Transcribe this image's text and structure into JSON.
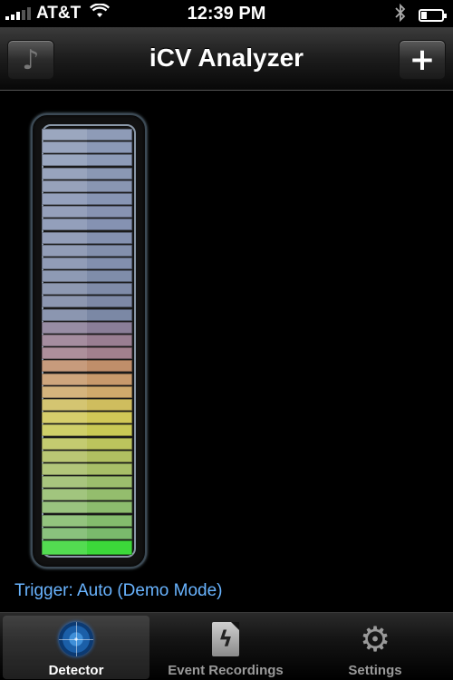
{
  "status_bar": {
    "carrier": "AT&T",
    "time": "12:39 PM",
    "signal_bars_filled": 3,
    "signal_bars_total": 5,
    "battery_level": 0.25
  },
  "nav": {
    "title": "iCV Analyzer",
    "left_icon": "music-note-icon",
    "right_icon": "plus-icon"
  },
  "meter": {
    "bar_colors": [
      "#8e9bb7",
      "#8b99b7",
      "#8d9bb8",
      "#8a98b4",
      "#8996b2",
      "#8795b4",
      "#8793b2",
      "#8592b2",
      "#8491b0",
      "#8390ad",
      "#828fae",
      "#7f8daa",
      "#7f8ba8",
      "#7e89a6",
      "#7b88a5",
      "#8a7e98",
      "#997e92",
      "#a2808e",
      "#c08e6a",
      "#c89a6c",
      "#cfaa6c",
      "#cfbd5e",
      "#d1c857",
      "#c9c955",
      "#bcc45d",
      "#b1c061",
      "#a8bf68",
      "#9cbe6d",
      "#94bd6d",
      "#8cbc6e",
      "#84bc6d",
      "#7aba6c",
      "#3cd83a"
    ],
    "active_color": "#3cd83a"
  },
  "trigger": {
    "text": "Trigger: Auto (Demo Mode)",
    "color": "#69b4ff"
  },
  "tabs": [
    {
      "label": "Detector",
      "icon": "radar-icon",
      "active": true
    },
    {
      "label": "Event Recordings",
      "icon": "document-icon",
      "active": false
    },
    {
      "label": "Settings",
      "icon": "gear-icon",
      "active": false
    }
  ]
}
